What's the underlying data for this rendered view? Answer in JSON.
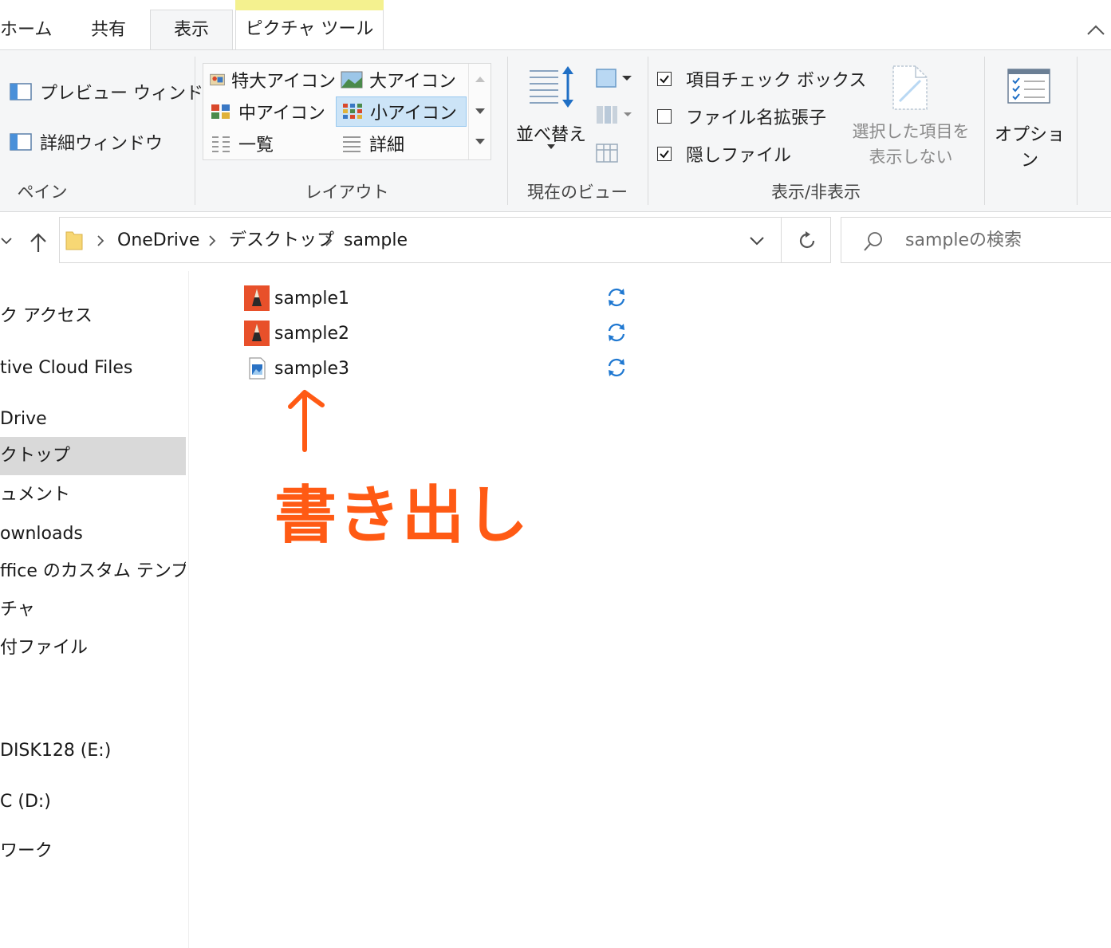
{
  "tabs": {
    "home": "ホーム",
    "share": "共有",
    "view": "表示",
    "picture_tools": "ピクチャ ツール"
  },
  "ribbon": {
    "pane": {
      "preview_window": "プレビュー ウィンドウ",
      "details_window": "詳細ウィンドウ",
      "label": "ペイン"
    },
    "layout": {
      "extra_large_icons": "特大アイコン",
      "large_icons": "大アイコン",
      "medium_icons": "中アイコン",
      "small_icons": "小アイコン",
      "list": "一覧",
      "details": "詳細",
      "label": "レイアウト"
    },
    "current_view": {
      "sort_by": "並べ替え",
      "label": "現在のビュー"
    },
    "show_hide": {
      "item_check_boxes": "項目チェック ボックス",
      "item_check_boxes_checked": true,
      "file_name_extensions": "ファイル名拡張子",
      "file_name_extensions_checked": false,
      "hidden_items": "隠しファイル",
      "hidden_items_checked": true,
      "hide_selected_line1": "選択した項目を",
      "hide_selected_line2": "表示しない",
      "label": "表示/非表示"
    },
    "options": "オプション"
  },
  "address": {
    "crumbs": [
      "OneDrive",
      "デスクトップ",
      "sample"
    ]
  },
  "search": {
    "placeholder": "sampleの検索"
  },
  "sidebar": {
    "items": [
      "ク アクセス",
      "tive Cloud Files",
      "Drive",
      "クトップ",
      "ュメント",
      "ownloads",
      "ffice のカスタム テンプレー",
      "チャ",
      "付ファイル",
      "DISK128 (E:)",
      "C (D:)",
      "ワーク"
    ],
    "selected_index": 3
  },
  "files": [
    {
      "name": "sample1",
      "icon": "sketchbook-icon"
    },
    {
      "name": "sample2",
      "icon": "sketchbook-icon"
    },
    {
      "name": "sample3",
      "icon": "image-file-icon"
    }
  ],
  "annotation": {
    "text": "書き出し",
    "color": "#ff5a14"
  },
  "colors": {
    "accent": "#0078d7",
    "selection": "#cce4f7",
    "context_tab": "#f4f18f",
    "ribbon_bg": "#f5f6f7"
  }
}
